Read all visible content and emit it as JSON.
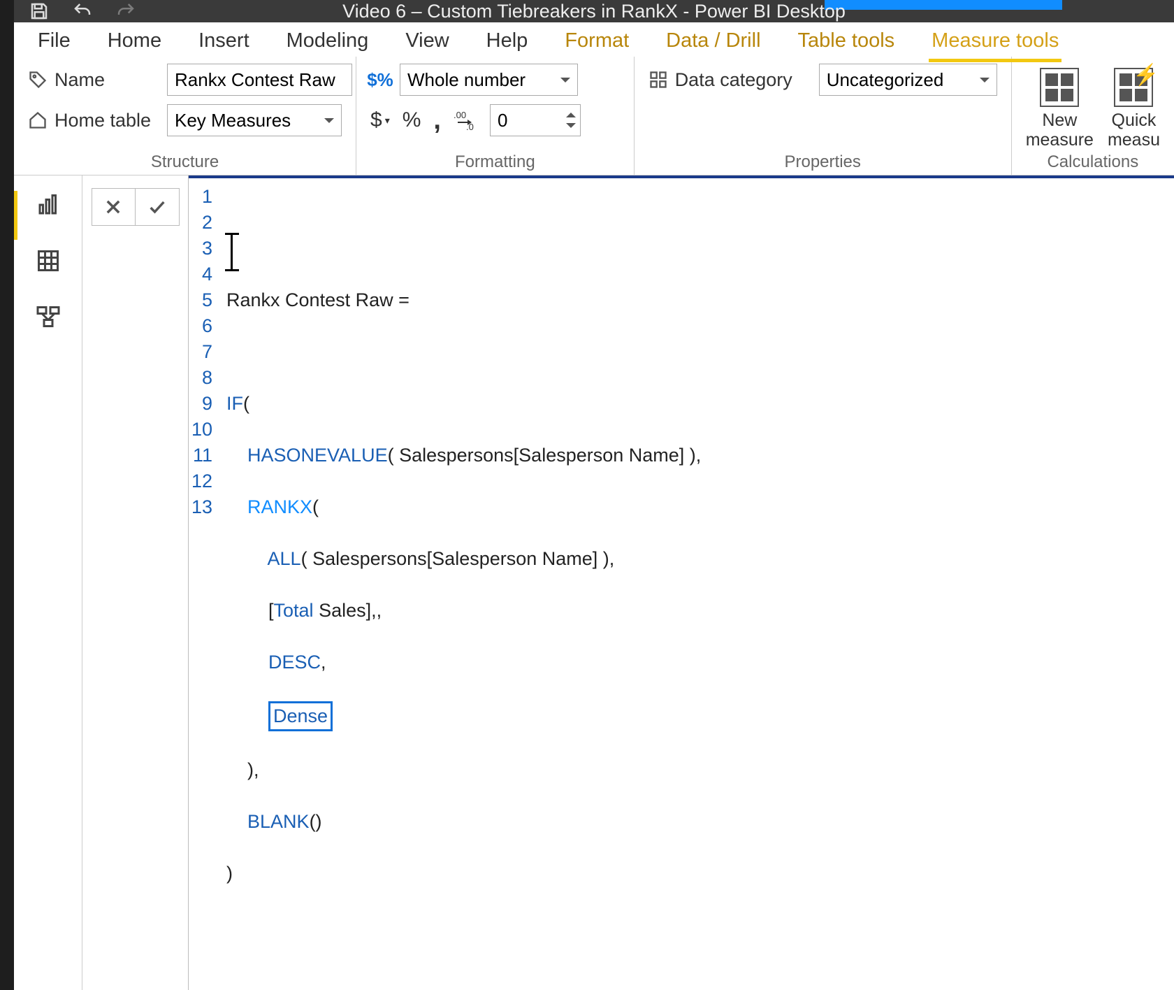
{
  "window": {
    "title": "Video 6 – Custom Tiebreakers in RankX - Power BI Desktop"
  },
  "tabs": {
    "file": "File",
    "home": "Home",
    "insert": "Insert",
    "modeling": "Modeling",
    "view": "View",
    "help": "Help",
    "format": "Format",
    "datadrill": "Data / Drill",
    "tabletools": "Table tools",
    "measuretools": "Measure tools"
  },
  "structure": {
    "group_label": "Structure",
    "name_label": "Name",
    "name_value": "Rankx Contest Raw",
    "hometable_label": "Home table",
    "hometable_value": "Key Measures"
  },
  "formatting": {
    "group_label": "Formatting",
    "datatype_value": "Whole number",
    "decimals_value": "0",
    "currency_symbol": "$",
    "percent_symbol": "%",
    "comma_symbol": ",",
    "precision_icon": ".00→.0"
  },
  "properties": {
    "group_label": "Properties",
    "datacategory_label": "Data category",
    "datacategory_value": "Uncategorized"
  },
  "calculations": {
    "group_label": "Calculations",
    "new_measure": "New\nmeasure",
    "quick_measure": "Quick\nmeasu"
  },
  "formula": {
    "lines": [
      "Rankx Contest Raw =",
      "",
      "IF(",
      "    HASONEVALUE( Salespersons[Salesperson Name] ),",
      "    RANKX(",
      "        ALL( Salespersons[Salesperson Name] ),",
      "        [Total Sales],,",
      "        DESC,",
      "        Dense",
      "    ),",
      "    BLANK()",
      ")",
      ""
    ],
    "line_numbers": [
      "1",
      "2",
      "3",
      "4",
      "5",
      "6",
      "7",
      "8",
      "9",
      "10",
      "11",
      "12",
      "13"
    ]
  }
}
